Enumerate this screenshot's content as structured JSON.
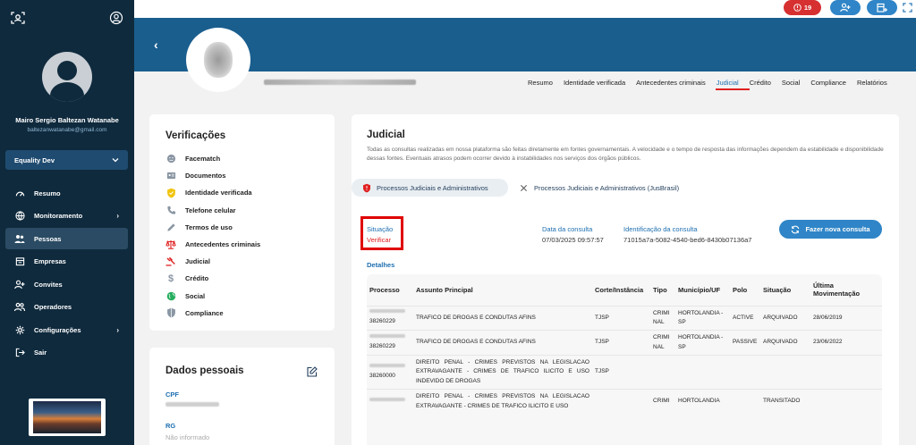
{
  "user": {
    "name": "Mairo Sergio Baltezan Watanabe",
    "email": "baltezanwatanabe@gmail.com"
  },
  "org": {
    "selected": "Equality Dev"
  },
  "nav": [
    {
      "label": "Resumo",
      "icon": "dashboard-icon",
      "active": false,
      "chevron": false
    },
    {
      "label": "Monitoramento",
      "icon": "globe-icon",
      "active": false,
      "chevron": true
    },
    {
      "label": "Pessoas",
      "icon": "people-icon",
      "active": true,
      "chevron": false
    },
    {
      "label": "Empresas",
      "icon": "building-icon",
      "active": false,
      "chevron": false
    },
    {
      "label": "Convites",
      "icon": "invite-icon",
      "active": false,
      "chevron": false
    },
    {
      "label": "Operadores",
      "icon": "operators-icon",
      "active": false,
      "chevron": false
    },
    {
      "label": "Configurações",
      "icon": "gear-icon",
      "active": false,
      "chevron": true
    },
    {
      "label": "Sair",
      "icon": "logout-icon",
      "active": false,
      "chevron": false
    }
  ],
  "topbar": {
    "alerts_count": "19"
  },
  "profile_tabs": [
    {
      "label": "Resumo",
      "active": false
    },
    {
      "label": "Identidade verificada",
      "active": false
    },
    {
      "label": "Antecedentes criminais",
      "active": false
    },
    {
      "label": "Judicial",
      "active": true
    },
    {
      "label": "Crédito",
      "active": false
    },
    {
      "label": "Social",
      "active": false
    },
    {
      "label": "Compliance",
      "active": false
    },
    {
      "label": "Relatórios",
      "active": false
    }
  ],
  "verifications": {
    "title": "Verificações",
    "items": [
      {
        "label": "Facematch",
        "icon": "face-icon",
        "color": "#8a96a3"
      },
      {
        "label": "Documentos",
        "icon": "document-icon",
        "color": "#8a96a3"
      },
      {
        "label": "Identidade verificada",
        "icon": "shield-check-icon",
        "color": "#f1c40f"
      },
      {
        "label": "Telefone celular",
        "icon": "phone-icon",
        "color": "#8a96a3"
      },
      {
        "label": "Termos de uso",
        "icon": "pen-icon",
        "color": "#8a96a3"
      },
      {
        "label": "Antecedentes criminais",
        "icon": "scale-icon",
        "color": "#e02020"
      },
      {
        "label": "Judicial",
        "icon": "gavel-icon",
        "color": "#e02020"
      },
      {
        "label": "Crédito",
        "icon": "dollar-icon",
        "color": "#8a96a3"
      },
      {
        "label": "Social",
        "icon": "globe-icon",
        "color": "#27ae60"
      },
      {
        "label": "Compliance",
        "icon": "shield-icon",
        "color": "#8a96a3"
      }
    ]
  },
  "personal": {
    "title": "Dados pessoais",
    "cpf_label": "CPF",
    "rg_label": "RG",
    "rg_value": "Não informado"
  },
  "judicial": {
    "title": "Judicial",
    "description": "Todas as consultas realizadas em nossa plataforma são feitas diretamente em fontes governamentais. A velocidade e o tempo de resposta das informações dependem da estabilidade e disponibilidade dessas fontes. Eventuais atrasos podem ocorrer devido à instabilidades nos serviços dos órgãos públicos.",
    "source_tabs": [
      {
        "label": "Processos Judiciais e Administrativos",
        "selected": true
      },
      {
        "label": "Processos Judiciais e Administrativos (JusBrasil)",
        "selected": false
      }
    ],
    "situation_label": "Situação",
    "situation_value": "Verificar",
    "date_label": "Data da consulta",
    "date_value": "07/03/2025 09:57:57",
    "id_label": "Identificação da consulta",
    "id_value": "71015a7a-5082-4540-bed6-8430b07136a7",
    "new_query_label": "Fazer nova consulta",
    "details_label": "Detalhes",
    "columns": [
      "Processo",
      "Assunto Principal",
      "Corte/Instância",
      "Tipo",
      "Município/UF",
      "Polo",
      "Situação",
      "Última Movimentação"
    ],
    "rows": [
      {
        "processo": "38260229",
        "assunto": "TRAFICO DE DROGAS E CONDUTAS AFINS",
        "corte": "TJSP",
        "tipo": "CRIMINAL",
        "municipio": "HORTOLANDIA - SP",
        "polo": "ACTIVE",
        "situacao": "ARQUIVADO",
        "ultima": "28/06/2019"
      },
      {
        "processo": "38260229",
        "assunto": "TRAFICO DE DROGAS E CONDUTAS AFINS",
        "corte": "TJSP",
        "tipo": "CRIMINAL",
        "municipio": "HORTOLANDIA - SP",
        "polo": "PASSIVE",
        "situacao": "ARQUIVADO",
        "ultima": "23/06/2022"
      },
      {
        "processo": "38260000",
        "assunto": "DIREITO PENAL - CRIMES PREVISTOS NA LEGISLACAO EXTRAVAGANTE - CRIMES DE TRAFICO ILICITO E USO INDEVIDO DE DROGAS",
        "corte": "TJSP",
        "tipo": "",
        "municipio": "",
        "polo": "",
        "situacao": "",
        "ultima": ""
      },
      {
        "processo": "",
        "assunto": "DIREITO PENAL - CRIMES PREVISTOS NA LEGISLACAO EXTRAVAGANTE - CRIMES DE TRAFICO ILICITO E USO",
        "corte": "",
        "tipo": "CRIMI",
        "municipio": "HORTOLANDIA",
        "polo": "",
        "situacao": "TRANSITADO",
        "ultima": ""
      }
    ]
  }
}
